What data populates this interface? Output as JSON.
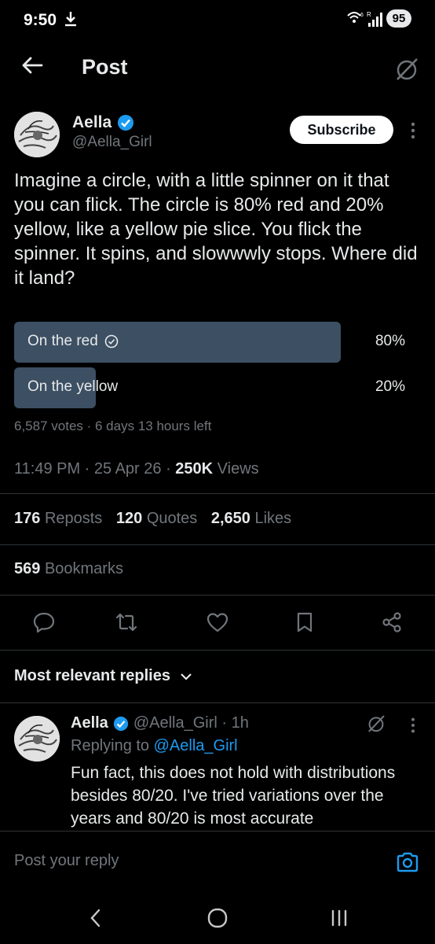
{
  "status_bar": {
    "time": "9:50",
    "battery": "95",
    "icons": [
      "download-icon",
      "wifi-6-icon",
      "signal-r-icon"
    ]
  },
  "header": {
    "title": "Post",
    "back_icon": "arrow-left-icon",
    "grok_icon": "grok-icon"
  },
  "post": {
    "author_name": "Aella",
    "author_handle": "@Aella_Girl",
    "subscribe_label": "Subscribe",
    "text": "Imagine a circle, with a little spinner on it that you can flick. The circle is 80% red and 20% yellow, like a yellow pie slice. You flick the spinner. It spins, and slowwwly stops.  Where did it land?",
    "poll": {
      "options": [
        {
          "label": "On the red",
          "percent_label": "80%",
          "fraction": 0.8,
          "selected": true
        },
        {
          "label": "On the yellow",
          "percent_label": "20%",
          "fraction": 0.2,
          "selected": false
        }
      ],
      "meta": "6,587 votes · 6 days 13 hours left"
    },
    "timestamp": "11:49 PM · 25 Apr 26 · ",
    "views_count": "250K",
    "views_label": " Views",
    "reposts_count": "176",
    "reposts_label": "Reposts",
    "quotes_count": "120",
    "quotes_label": "Quotes",
    "likes_count": "2,650",
    "likes_label": "Likes",
    "bookmarks_count": "569",
    "bookmarks_label": "Bookmarks"
  },
  "actions": [
    "reply-icon",
    "repost-icon",
    "like-icon",
    "bookmark-icon",
    "share-icon"
  ],
  "replies": {
    "sort_label": "Most relevant replies",
    "items": [
      {
        "author_name": "Aella",
        "handle_time": "@Aella_Girl · 1h",
        "replying_prefix": "Replying to ",
        "replying_handle": "@Aella_Girl",
        "text": "Fun fact, this does not hold with distributions besides 80/20. I've tried variations over the years and 80/20 is most accurate"
      }
    ]
  },
  "composer": {
    "placeholder": "Post your reply"
  },
  "colors": {
    "background": "#000000",
    "text": "#e7e9ea",
    "muted": "#71767b",
    "accent": "#1d9bf0",
    "poll_fill": "#3c4f63"
  }
}
